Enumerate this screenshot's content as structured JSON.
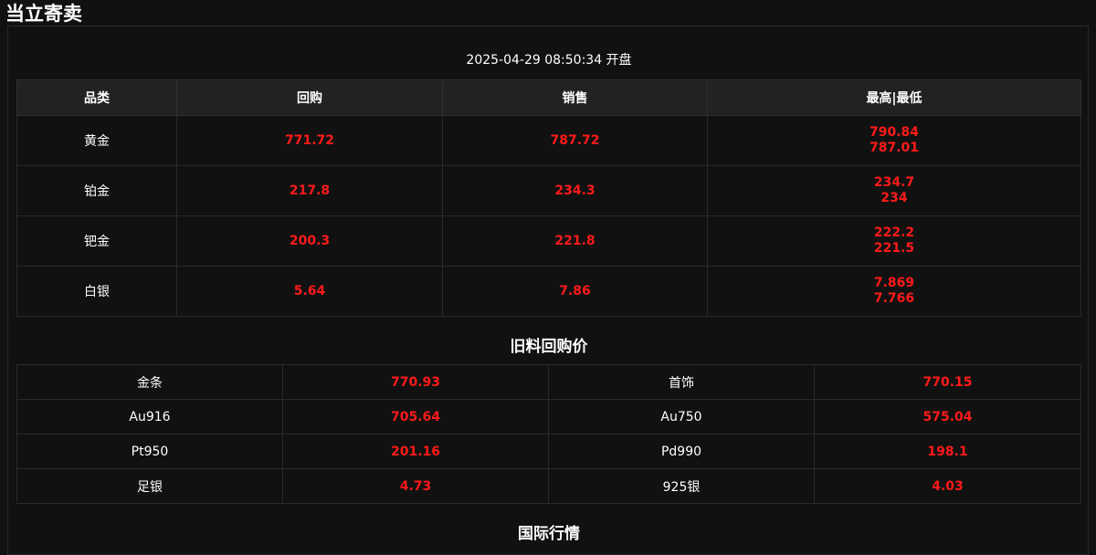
{
  "page": {
    "title": "当立寄卖"
  },
  "quote": {
    "timestamp": "2025-04-29 08:50:34 开盘",
    "headers": [
      "品类",
      "回购",
      "销售",
      "最高|最低"
    ],
    "rows": [
      {
        "name": "黄金",
        "buy": "771.72",
        "sell": "787.72",
        "high": "790.84",
        "low": "787.01"
      },
      {
        "name": "铂金",
        "buy": "217.8",
        "sell": "234.3",
        "high": "234.7",
        "low": "234"
      },
      {
        "name": "钯金",
        "buy": "200.3",
        "sell": "221.8",
        "high": "222.2",
        "low": "221.5"
      },
      {
        "name": "白银",
        "buy": "5.64",
        "sell": "7.86",
        "high": "7.869",
        "low": "7.766"
      }
    ]
  },
  "recycle": {
    "title": "旧料回购价",
    "rows": [
      {
        "name1": "金条",
        "price1": "770.93",
        "name2": "首饰",
        "price2": "770.15"
      },
      {
        "name1": "Au916",
        "price1": "705.64",
        "name2": "Au750",
        "price2": "575.04"
      },
      {
        "name1": "Pt950",
        "price1": "201.16",
        "name2": "Pd990",
        "price2": "198.1"
      },
      {
        "name1": "足银",
        "price1": "4.73",
        "name2": "925银",
        "price2": "4.03"
      }
    ]
  },
  "international": {
    "title": "国际行情"
  },
  "colors": {
    "background": "#111111",
    "price": "#ff1a1a",
    "header_bg": "#222222"
  }
}
